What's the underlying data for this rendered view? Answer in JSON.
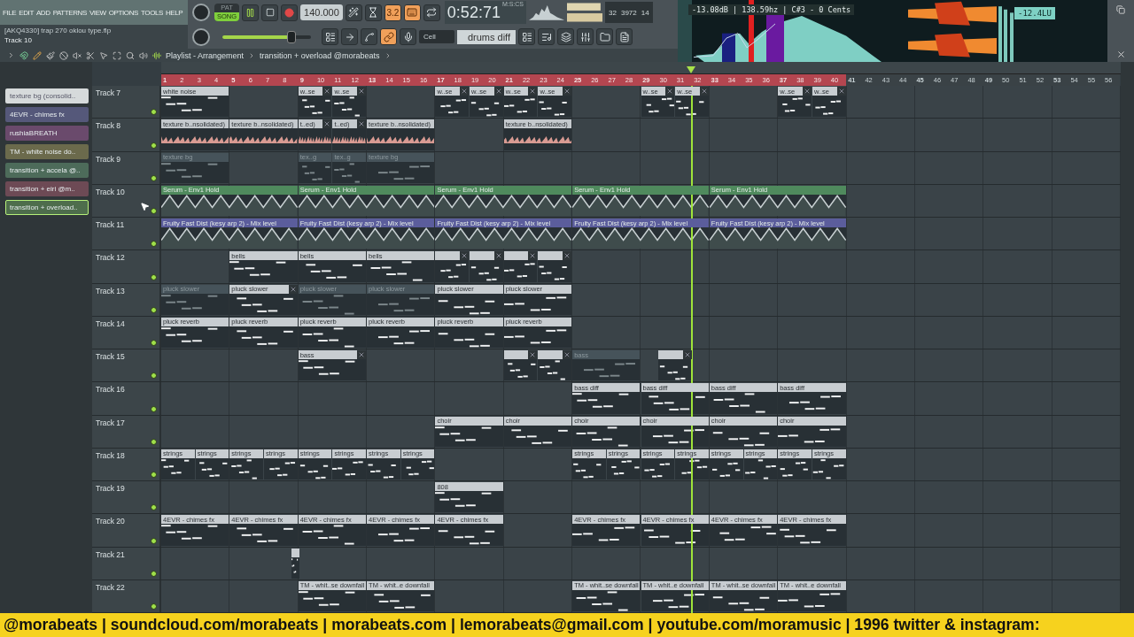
{
  "menu": {
    "items": [
      "FILE",
      "EDIT",
      "ADD",
      "PATTERNS",
      "VIEW",
      "OPTIONS",
      "TOOLS",
      "HELP"
    ]
  },
  "project": {
    "file": "[AKQ4330] trap 270 oklou type.flp",
    "hint": "Track 10"
  },
  "transport": {
    "modes": [
      {
        "label": "PAT",
        "selected": false
      },
      {
        "label": "SONG",
        "selected": true
      }
    ],
    "playing": true,
    "recording": true,
    "tempo": "140.000",
    "master_volume": {
      "level": 0.78
    }
  },
  "toolbar_top": [
    {
      "kind": "metronome",
      "on": false
    },
    {
      "kind": "wait",
      "on": false
    },
    {
      "kind": "countdown",
      "label": "3.2",
      "on": true
    },
    {
      "kind": "typing",
      "on": true
    },
    {
      "kind": "loop",
      "on": false
    }
  ],
  "toolbar_bottom": [
    {
      "kind": "step",
      "on": false
    },
    {
      "kind": "arrow",
      "on": false
    },
    {
      "kind": "blend",
      "on": false
    },
    {
      "kind": "link",
      "on": true
    },
    {
      "kind": "mic",
      "on": false
    }
  ],
  "time": {
    "value": "0:52:71",
    "unit": "M:S:CS"
  },
  "cpu": {
    "values": [
      "32",
      "3972",
      "14"
    ]
  },
  "snap": {
    "value": "Cell"
  },
  "pattern_selector": {
    "value": "drums diff"
  },
  "visualizer": {
    "readout": "-13.08dB | 138.59hz | C#3 - 0 Cents",
    "loudness": "-12.4LU"
  },
  "playlist": {
    "title": "Playlist - Arrangement",
    "breadcrumb": "transition + overload @morabeats",
    "playhead": {
      "level": 0.552
    }
  },
  "pattern_picker": [
    {
      "label": "texture bg (consolid..",
      "color": "#d6dadb",
      "selected": false
    },
    {
      "label": "4EVR - chimes fx",
      "color": "#55587a",
      "selected": false
    },
    {
      "label": "rushiaBREATH",
      "color": "#6a4a6c",
      "selected": false
    },
    {
      "label": "TM - white noise do..",
      "color": "#6b6a4c",
      "selected": false
    },
    {
      "label": "transition + accela @..",
      "color": "#4d6b5a",
      "selected": false
    },
    {
      "label": "transition + eiri @m..",
      "color": "#6d4a55",
      "selected": false
    },
    {
      "label": "transition + overload..",
      "color": "#4e6d4c",
      "selected": true
    }
  ],
  "ruler": [
    {
      "n": "1",
      "selected": true
    },
    {
      "n": "2",
      "selected": true
    },
    {
      "n": "3",
      "selected": true
    },
    {
      "n": "4",
      "selected": true
    },
    {
      "n": "5",
      "selected": true
    },
    {
      "n": "6",
      "selected": true
    },
    {
      "n": "7",
      "selected": true
    },
    {
      "n": "8",
      "selected": true
    },
    {
      "n": "9",
      "selected": true
    },
    {
      "n": "10",
      "selected": true
    },
    {
      "n": "11",
      "selected": true
    },
    {
      "n": "12",
      "selected": true
    },
    {
      "n": "13",
      "selected": true
    },
    {
      "n": "14",
      "selected": true
    },
    {
      "n": "15",
      "selected": true
    },
    {
      "n": "16",
      "selected": true
    },
    {
      "n": "17",
      "selected": true
    },
    {
      "n": "18",
      "selected": true
    },
    {
      "n": "19",
      "selected": true
    },
    {
      "n": "20",
      "selected": true
    },
    {
      "n": "21",
      "selected": true
    },
    {
      "n": "22",
      "selected": true
    },
    {
      "n": "23",
      "selected": true
    },
    {
      "n": "24",
      "selected": true
    },
    {
      "n": "25",
      "selected": true
    },
    {
      "n": "26",
      "selected": true
    },
    {
      "n": "27",
      "selected": true
    },
    {
      "n": "28",
      "selected": true
    },
    {
      "n": "29",
      "selected": true
    },
    {
      "n": "30",
      "selected": true
    },
    {
      "n": "31",
      "selected": true
    },
    {
      "n": "32",
      "selected": true
    },
    {
      "n": "33",
      "selected": true
    },
    {
      "n": "34",
      "selected": true
    },
    {
      "n": "35",
      "selected": true
    },
    {
      "n": "36",
      "selected": true
    },
    {
      "n": "37",
      "selected": true
    },
    {
      "n": "38",
      "selected": true
    },
    {
      "n": "39",
      "selected": true
    },
    {
      "n": "40",
      "selected": true
    },
    {
      "n": "41",
      "selected": false
    },
    {
      "n": "42",
      "selected": false
    },
    {
      "n": "43",
      "selected": false
    },
    {
      "n": "44",
      "selected": false
    },
    {
      "n": "45",
      "selected": false
    },
    {
      "n": "46",
      "selected": false
    },
    {
      "n": "47",
      "selected": false
    },
    {
      "n": "48",
      "selected": false
    },
    {
      "n": "49",
      "selected": false
    },
    {
      "n": "50",
      "selected": false
    },
    {
      "n": "51",
      "selected": false
    },
    {
      "n": "52",
      "selected": false
    },
    {
      "n": "53",
      "selected": false
    },
    {
      "n": "54",
      "selected": false
    },
    {
      "n": "55",
      "selected": false
    },
    {
      "n": "56",
      "selected": false
    }
  ],
  "tracks": [
    {
      "name": "Track 7",
      "on": true,
      "clips": [
        {
          "kind": "pattern",
          "label": "white noise",
          "x": false
        },
        {
          "kind": "pattern",
          "label": "w..se",
          "x": true
        },
        {
          "kind": "pattern",
          "label": "w..se",
          "x": true
        },
        {
          "kind": "pattern",
          "label": "w..se",
          "x": true
        },
        {
          "kind": "pattern",
          "label": "w..se",
          "x": true
        },
        {
          "kind": "pattern",
          "label": "w..se",
          "x": true
        },
        {
          "kind": "pattern",
          "label": "w..se",
          "x": true
        },
        {
          "kind": "pattern",
          "label": "w..se",
          "x": true
        },
        {
          "kind": "pattern",
          "label": "w..se",
          "x": true
        },
        {
          "kind": "pattern",
          "label": "w..se",
          "x": true
        },
        {
          "kind": "pattern",
          "label": "w..se",
          "x": true
        }
      ]
    },
    {
      "name": "Track 8",
      "on": true,
      "clips": [
        {
          "kind": "audio",
          "label": "texture b..nsolidated)",
          "x": false
        },
        {
          "kind": "audio",
          "label": "texture b..nsolidated)",
          "x": false
        },
        {
          "kind": "audio",
          "label": "t..ed)",
          "x": true
        },
        {
          "kind": "audio",
          "label": "t..ed)",
          "x": true
        },
        {
          "kind": "audio",
          "label": "texture b..nsolidated)",
          "x": false
        },
        {
          "kind": "audio",
          "label": "texture b..nsolidated)",
          "x": false
        }
      ]
    },
    {
      "name": "Track 9",
      "on": true,
      "clips": [
        {
          "kind": "ghost",
          "label": "texture bg",
          "x": false
        },
        {
          "kind": "ghost",
          "label": "tex..g",
          "x": false
        },
        {
          "kind": "ghost",
          "label": "tex..g",
          "x": false
        },
        {
          "kind": "ghost",
          "label": "texture bg",
          "x": false
        }
      ]
    },
    {
      "name": "Track 10",
      "on": true,
      "clips": [
        {
          "kind": "automation",
          "color": "#4f8a5d",
          "label": "Serum - Env1 Hold",
          "x": false
        },
        {
          "kind": "automation",
          "color": "#4f8a5d",
          "label": "Serum - Env1 Hold",
          "x": false
        },
        {
          "kind": "automation",
          "color": "#4f8a5d",
          "label": "Serum - Env1 Hold",
          "x": false
        },
        {
          "kind": "automation",
          "color": "#4f8a5d",
          "label": "Serum - Env1 Hold",
          "x": false
        },
        {
          "kind": "automation",
          "color": "#4f8a5d",
          "label": "Serum - Env1 Hold",
          "x": false
        }
      ]
    },
    {
      "name": "Track 11",
      "on": true,
      "clips": [
        {
          "kind": "automation",
          "color": "#5b5d9c",
          "label": "Fruity Fast Dist (kesy arp 2) - Mix level",
          "x": false
        },
        {
          "kind": "automation",
          "color": "#5b5d9c",
          "label": "Fruity Fast Dist (kesy arp 2) - Mix level",
          "x": false
        },
        {
          "kind": "automation",
          "color": "#5b5d9c",
          "label": "Fruity Fast Dist (kesy arp 2) - Mix level",
          "x": false
        },
        {
          "kind": "automation",
          "color": "#5b5d9c",
          "label": "Fruity Fast Dist (kesy arp 2) - Mix level",
          "x": false
        },
        {
          "kind": "automation",
          "color": "#5b5d9c",
          "label": "Fruity Fast Dist (kesy arp 2) - Mix level",
          "x": false
        }
      ]
    },
    {
      "name": "Track 12",
      "on": true,
      "clips": [
        {
          "kind": "pattern",
          "label": "bells",
          "x": false
        },
        {
          "kind": "pattern",
          "label": "bells",
          "x": false
        },
        {
          "kind": "pattern",
          "label": "bells",
          "x": false
        },
        {
          "kind": "pattern",
          "x": true
        },
        {
          "kind": "pattern",
          "x": true
        },
        {
          "kind": "pattern",
          "x": true
        },
        {
          "kind": "pattern",
          "x": true
        }
      ]
    },
    {
      "name": "Track 13",
      "on": true,
      "clips": [
        {
          "kind": "ghost",
          "label": "pluck slower",
          "x": false
        },
        {
          "kind": "pattern",
          "label": "pluck slower",
          "x": true
        },
        {
          "kind": "ghost",
          "label": "pluck slower",
          "x": false
        },
        {
          "kind": "ghost",
          "label": "pluck slower",
          "x": false
        },
        {
          "kind": "pattern",
          "label": "pluck slower",
          "x": false
        },
        {
          "kind": "pattern",
          "label": "pluck slower",
          "x": false
        }
      ]
    },
    {
      "name": "Track 14",
      "on": true,
      "clips": [
        {
          "kind": "pattern",
          "label": "pluck reverb",
          "x": false
        },
        {
          "kind": "pattern",
          "label": "pluck reverb",
          "x": false
        },
        {
          "kind": "pattern",
          "label": "pluck reverb",
          "x": false
        },
        {
          "kind": "pattern",
          "label": "pluck reverb",
          "x": false
        },
        {
          "kind": "pattern",
          "label": "pluck reverb",
          "x": false
        },
        {
          "kind": "pattern",
          "label": "pluck reverb",
          "x": false
        }
      ]
    },
    {
      "name": "Track 15",
      "on": true,
      "clips": [
        {
          "kind": "pattern",
          "label": "bass",
          "x": true
        },
        {
          "kind": "pattern",
          "x": true
        },
        {
          "kind": "pattern",
          "x": true
        },
        {
          "kind": "ghost",
          "label": "bass",
          "x": false
        },
        {
          "kind": "pattern",
          "x": true
        }
      ]
    },
    {
      "name": "Track 16",
      "on": true,
      "clips": [
        {
          "kind": "pattern",
          "label": "bass diff",
          "x": false
        },
        {
          "kind": "pattern",
          "label": "bass diff",
          "x": false
        },
        {
          "kind": "pattern",
          "label": "bass diff",
          "x": false
        },
        {
          "kind": "pattern",
          "label": "bass diff",
          "x": false
        }
      ]
    },
    {
      "name": "Track 17",
      "on": true,
      "clips": [
        {
          "kind": "pattern",
          "label": "choir",
          "x": false
        },
        {
          "kind": "pattern",
          "label": "choir",
          "x": false
        },
        {
          "kind": "pattern",
          "label": "choir",
          "x": false
        },
        {
          "kind": "pattern",
          "label": "choir",
          "x": false
        },
        {
          "kind": "pattern",
          "label": "choir",
          "x": false
        },
        {
          "kind": "pattern",
          "label": "choir",
          "x": false
        }
      ]
    },
    {
      "name": "Track 18",
      "on": true,
      "clips": [
        {
          "kind": "pattern",
          "label": "strings",
          "x": false
        },
        {
          "kind": "pattern",
          "label": "strings",
          "x": false
        },
        {
          "kind": "pattern",
          "label": "strings",
          "x": false
        },
        {
          "kind": "pattern",
          "label": "strings",
          "x": false
        },
        {
          "kind": "pattern",
          "label": "strings",
          "x": false
        },
        {
          "kind": "pattern",
          "label": "strings",
          "x": false
        },
        {
          "kind": "pattern",
          "label": "strings",
          "x": false
        },
        {
          "kind": "pattern",
          "label": "strings",
          "x": false
        },
        {
          "kind": "pattern",
          "label": "strings",
          "x": false
        },
        {
          "kind": "pattern",
          "label": "strings",
          "x": false
        },
        {
          "kind": "pattern",
          "label": "strings",
          "x": false
        },
        {
          "kind": "pattern",
          "label": "strings",
          "x": false
        },
        {
          "kind": "pattern",
          "label": "strings",
          "x": false
        },
        {
          "kind": "pattern",
          "label": "strings",
          "x": false
        },
        {
          "kind": "pattern",
          "label": "strings",
          "x": false
        },
        {
          "kind": "pattern",
          "label": "strings",
          "x": false
        }
      ]
    },
    {
      "name": "Track 19",
      "on": true,
      "clips": [
        {
          "kind": "pattern",
          "label": "808",
          "x": false
        }
      ]
    },
    {
      "name": "Track 20",
      "on": true,
      "clips": [
        {
          "kind": "pattern",
          "label": "4EVR - chimes fx",
          "x": false
        },
        {
          "kind": "pattern",
          "label": "4EVR - chimes fx",
          "x": false
        },
        {
          "kind": "pattern",
          "label": "4EVR - chimes fx",
          "x": false
        },
        {
          "kind": "pattern",
          "label": "4EVR - chimes fx",
          "x": false
        },
        {
          "kind": "pattern",
          "label": "4EVR - chimes fx",
          "x": false
        },
        {
          "kind": "pattern",
          "label": "4EVR - chimes fx",
          "x": false
        },
        {
          "kind": "pattern",
          "label": "4EVR - chimes fx",
          "x": false
        },
        {
          "kind": "pattern",
          "label": "4EVR - chimes fx",
          "x": false
        },
        {
          "kind": "pattern",
          "label": "4EVR - chimes fx",
          "x": false
        }
      ]
    },
    {
      "name": "Track 21",
      "on": true,
      "clips": [
        {
          "kind": "pattern",
          "x": false
        }
      ]
    },
    {
      "name": "Track 22",
      "on": true,
      "clips": [
        {
          "kind": "pattern",
          "label": "TM - whit..se downfall",
          "x": false
        },
        {
          "kind": "pattern",
          "label": "TM - whit..e downfall",
          "x": false
        },
        {
          "kind": "pattern",
          "label": "TM - whit..se downfall",
          "x": false
        },
        {
          "kind": "pattern",
          "label": "TM - whit..e downfall",
          "x": false
        },
        {
          "kind": "pattern",
          "label": "TM - whit..se downfall",
          "x": false
        },
        {
          "kind": "pattern",
          "label": "TM - whit..e downfall",
          "x": false
        }
      ]
    }
  ],
  "banner": {
    "text": "@morabeats | soundcloud.com/morabeats | morabeats.com | lemorabeats@gmail.com | youtube.com/moramusic | 1996  twitter & instagram:"
  }
}
